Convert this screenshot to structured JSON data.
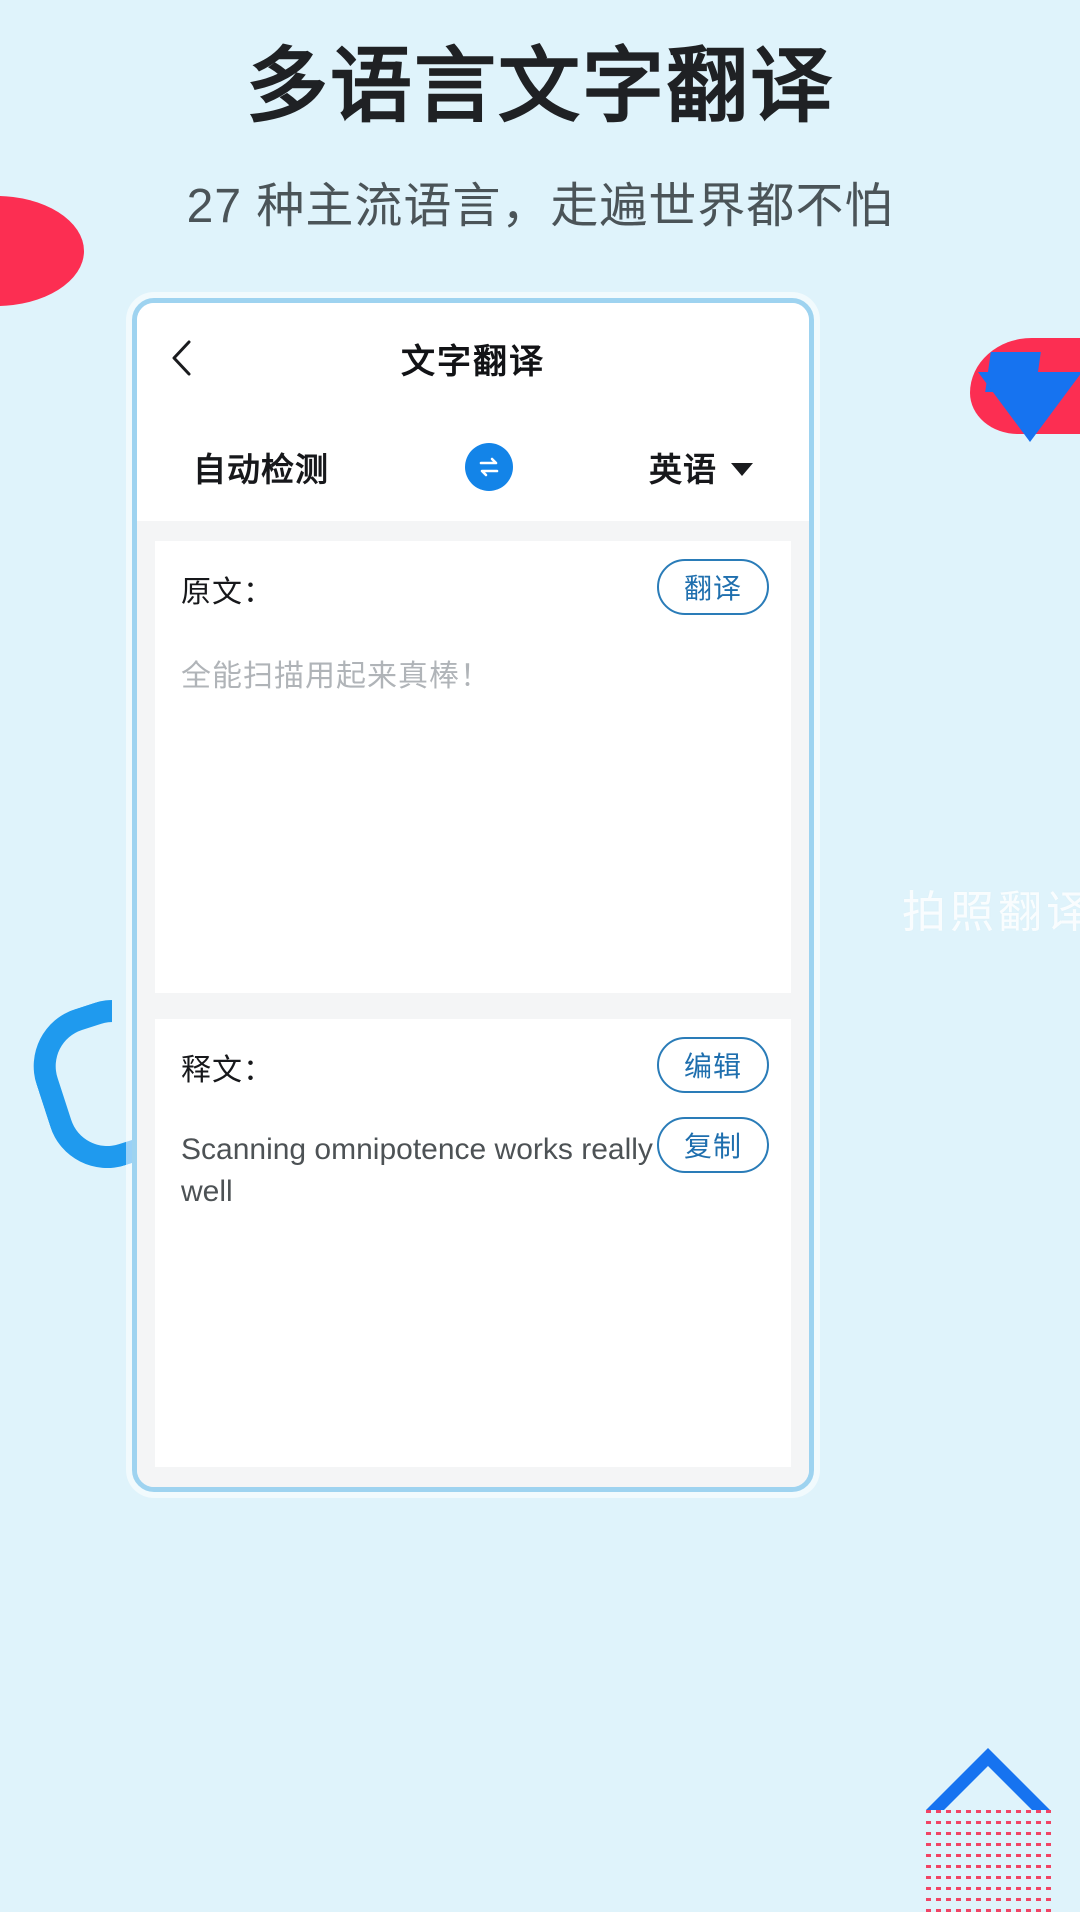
{
  "page": {
    "background_color": "#dff3fb",
    "title": "多语言文字翻译",
    "subtitle": "27 种主流语言，走遍世界都不怕",
    "watermark": "拍照翻译"
  },
  "colors": {
    "accent_blue": "#1384e8",
    "outline_blue": "#2a7cb8",
    "frame_blue": "#9ed3f0",
    "red": "#fc2e52",
    "panel_gray": "#f4f5f6",
    "placeholder_gray": "#b0b4b8"
  },
  "phone": {
    "navbar": {
      "back_icon": "chevron-left-icon",
      "title": "文字翻译"
    },
    "language_bar": {
      "source_label": "自动检测",
      "swap_icon": "swap-horizontal-icon",
      "target_label": "英语",
      "caret_icon": "chevron-down-icon"
    },
    "source_panel": {
      "label": "原文：",
      "action_label": "翻译",
      "placeholder": "全能扫描用起来真棒！",
      "value": ""
    },
    "result_panel": {
      "label": "释文：",
      "edit_label": "编辑",
      "copy_label": "复制",
      "text": "Scanning omnipotence works really well"
    }
  }
}
